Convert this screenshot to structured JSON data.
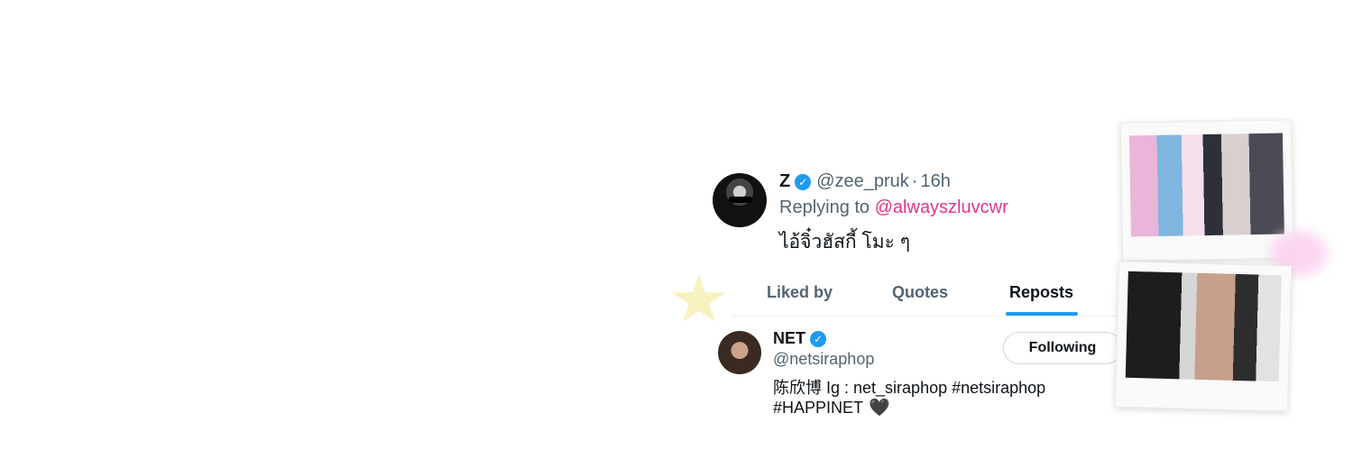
{
  "tweet": {
    "name": "Z",
    "handle": "@zee_pruk",
    "dot": "·",
    "time": "16h",
    "replying_label": "Replying to",
    "replying_mention": "@alwayszluvcwr",
    "text": "ไอ้จิ๋วฮัสกี้ โมะ ๆ"
  },
  "tabs": [
    {
      "label": "Liked by",
      "active": false
    },
    {
      "label": "Quotes",
      "active": false
    },
    {
      "label": "Reposts",
      "active": true
    }
  ],
  "user": {
    "name": "NET",
    "handle": "@netsiraphop",
    "bio_line1": "陈欣博 Ig : net_siraphop #netsiraphop",
    "bio_line2": "#HAPPINET",
    "follow_label": "Following"
  },
  "icons": {
    "verified": "verified-badge-icon",
    "heart": "black-heart-icon"
  },
  "colors": {
    "accent": "#1d9bf0",
    "mention": "#e0368f",
    "secondary_text": "#536471"
  }
}
